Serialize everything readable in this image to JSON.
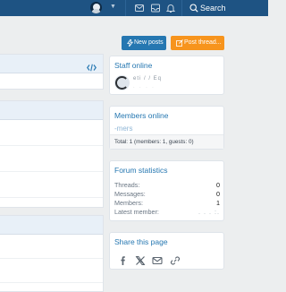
{
  "topbar": {
    "search_label": "Search"
  },
  "actions": {
    "new_posts": "New posts",
    "post_thread": "Post thread..."
  },
  "staff_online": {
    "title": "Staff online",
    "member_name": "eti / / Eq",
    "member_role": "· · · ·"
  },
  "members_online": {
    "title": "Members online",
    "users": "-mers",
    "footer": "Total: 1 (members: 1, guests: 0)"
  },
  "forum_statistics": {
    "title": "Forum statistics",
    "rows": [
      {
        "label": "Threads:",
        "value": "0"
      },
      {
        "label": "Messages:",
        "value": "0"
      },
      {
        "label": "Members:",
        "value": "1"
      },
      {
        "label": "Latest member:",
        "value": ". . .  :."
      }
    ]
  },
  "share": {
    "title": "Share this page",
    "icons": [
      "facebook-icon",
      "x-twitter-icon",
      "email-icon",
      "link-icon"
    ]
  },
  "colors": {
    "topbar": "#1e5383",
    "accent_blue": "#2577b1",
    "accent_orange": "#f7941d",
    "page_bg": "#eceeef"
  }
}
